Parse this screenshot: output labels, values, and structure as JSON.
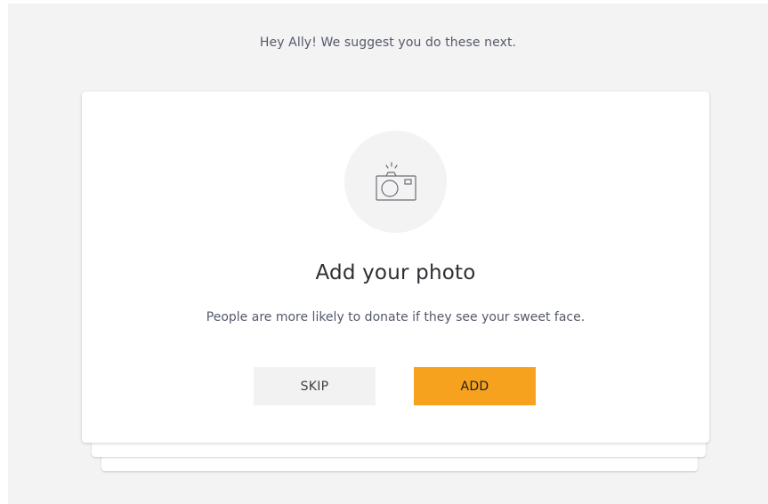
{
  "greeting": "Hey Ally! We suggest you do these next.",
  "card": {
    "icon": "camera-icon",
    "title": "Add your photo",
    "description": "People are more likely to donate if they see your sweet face.",
    "skip_label": "SKIP",
    "add_label": "ADD"
  },
  "colors": {
    "accent": "#f6a21e",
    "background": "#f3f3f3",
    "card": "#ffffff",
    "text_secondary": "#55596b",
    "text_primary": "#2c2f33"
  }
}
